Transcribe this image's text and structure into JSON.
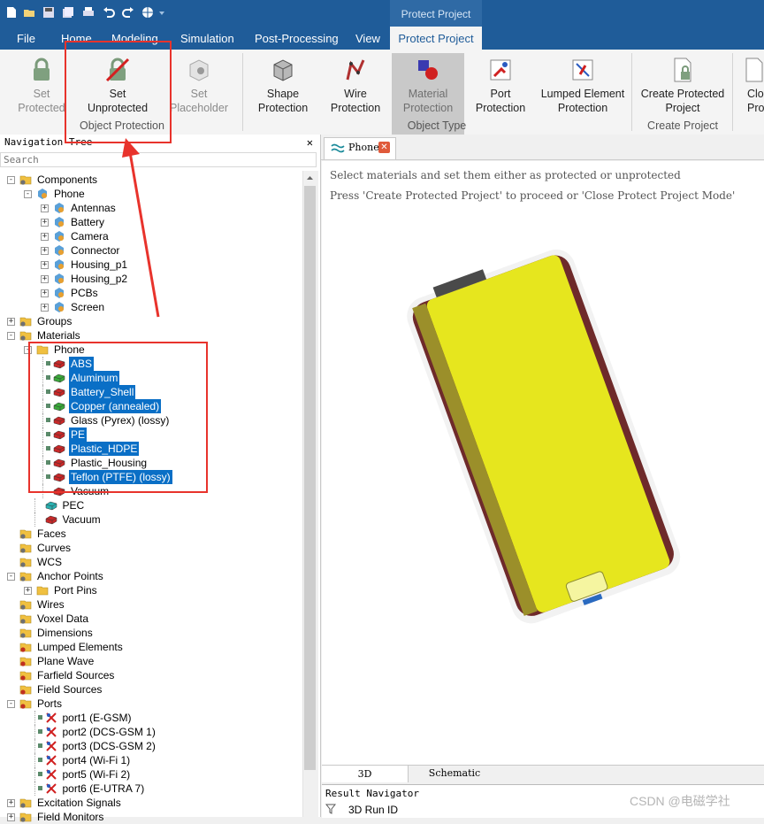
{
  "ribbon": {
    "context_title": "Protect Project",
    "tabs": [
      "File",
      "Home",
      "Modeling",
      "Simulation",
      "Post-Processing",
      "View"
    ],
    "active_tab": "Protect Project",
    "buttons": {
      "set_protected": [
        "Set",
        "Protected"
      ],
      "set_unprotected": [
        "Set",
        "Unprotected"
      ],
      "set_placeholder": [
        "Set",
        "Placeholder"
      ],
      "shape_protection": [
        "Shape",
        "Protection"
      ],
      "wire_protection": [
        "Wire",
        "Protection"
      ],
      "material_protection": [
        "Material",
        "Protection"
      ],
      "port_protection": [
        "Port",
        "Protection"
      ],
      "lumped_element_protection": [
        "Lumped Element",
        "Protection"
      ],
      "create_protected_project": [
        "Create Protected",
        "Project"
      ],
      "close_protect": [
        "Clos",
        "Proj"
      ]
    },
    "groups": {
      "object_protection": "Object Protection",
      "object_type": "Object Type",
      "create_project": "Create Project"
    }
  },
  "nav": {
    "title": "Navigation Tree",
    "close_glyph": "✕",
    "search_placeholder": "Search",
    "rows": [
      {
        "label": "Components",
        "indent": 0,
        "exp": "-",
        "icon": "folder-gear-icon"
      },
      {
        "label": "Phone",
        "indent": 1,
        "exp": "-",
        "icon": "component-icon"
      },
      {
        "label": "Antennas",
        "indent": 2,
        "exp": "+",
        "icon": "component-icon"
      },
      {
        "label": "Battery",
        "indent": 2,
        "exp": "+",
        "icon": "component-icon"
      },
      {
        "label": "Camera",
        "indent": 2,
        "exp": "+",
        "icon": "component-icon"
      },
      {
        "label": "Connector",
        "indent": 2,
        "exp": "+",
        "icon": "component-icon"
      },
      {
        "label": "Housing_p1",
        "indent": 2,
        "exp": "+",
        "icon": "component-icon"
      },
      {
        "label": "Housing_p2",
        "indent": 2,
        "exp": "+",
        "icon": "component-icon"
      },
      {
        "label": "PCBs",
        "indent": 2,
        "exp": "+",
        "icon": "component-icon"
      },
      {
        "label": "Screen",
        "indent": 2,
        "exp": "+",
        "icon": "component-icon"
      },
      {
        "label": "Groups",
        "indent": 0,
        "exp": "+",
        "icon": "folder-gear-icon"
      },
      {
        "label": "Materials",
        "indent": 0,
        "exp": "-",
        "icon": "folder-gear-icon"
      },
      {
        "label": "Phone",
        "indent": 1,
        "exp": "-",
        "icon": "folder-icon"
      },
      {
        "label": "ABS",
        "indent": 2,
        "exp": "",
        "icon": "material-red-icon",
        "lock": true,
        "sel": true
      },
      {
        "label": "Aluminum",
        "indent": 2,
        "exp": "",
        "icon": "material-green-icon",
        "lock": true,
        "sel": true
      },
      {
        "label": "Battery_Shell",
        "indent": 2,
        "exp": "",
        "icon": "material-red-icon",
        "lock": true,
        "sel": true
      },
      {
        "label": "Copper (annealed)",
        "indent": 2,
        "exp": "",
        "icon": "material-green-icon",
        "lock": true,
        "sel": true
      },
      {
        "label": "Glass (Pyrex) (lossy)",
        "indent": 2,
        "exp": "",
        "icon": "material-red-icon",
        "lock": true,
        "sel": false
      },
      {
        "label": "PE",
        "indent": 2,
        "exp": "",
        "icon": "material-red-icon",
        "lock": true,
        "sel": true
      },
      {
        "label": "Plastic_HDPE",
        "indent": 2,
        "exp": "",
        "icon": "material-red-icon",
        "lock": true,
        "sel": true
      },
      {
        "label": "Plastic_Housing",
        "indent": 2,
        "exp": "",
        "icon": "material-red-icon",
        "lock": true,
        "sel": false
      },
      {
        "label": "Teflon (PTFE) (lossy)",
        "indent": 2,
        "exp": "",
        "icon": "material-red-icon",
        "lock": true,
        "sel": true
      },
      {
        "label": "Vacuum",
        "indent": 2,
        "exp": "",
        "icon": "material-red-icon",
        "lock": false,
        "sel": false
      },
      {
        "label": "PEC",
        "indent": 1.5,
        "exp": "",
        "icon": "material-teal-icon",
        "lock": false,
        "sel": false
      },
      {
        "label": "Vacuum",
        "indent": 1.5,
        "exp": "",
        "icon": "material-red-icon",
        "lock": false,
        "sel": false
      },
      {
        "label": "Faces",
        "indent": 0,
        "exp": "",
        "icon": "folder-gear-icon"
      },
      {
        "label": "Curves",
        "indent": 0,
        "exp": "",
        "icon": "folder-gear-icon"
      },
      {
        "label": "WCS",
        "indent": 0,
        "exp": "",
        "icon": "folder-gear-icon"
      },
      {
        "label": "Anchor Points",
        "indent": 0,
        "exp": "-",
        "icon": "folder-gear-icon"
      },
      {
        "label": "Port Pins",
        "indent": 1,
        "exp": "+",
        "icon": "folder-icon"
      },
      {
        "label": "Wires",
        "indent": 0,
        "exp": "",
        "icon": "folder-gear-icon"
      },
      {
        "label": "Voxel Data",
        "indent": 0,
        "exp": "",
        "icon": "folder-gear-icon"
      },
      {
        "label": "Dimensions",
        "indent": 0,
        "exp": "",
        "icon": "folder-gear-icon"
      },
      {
        "label": "Lumped Elements",
        "indent": 0,
        "exp": "",
        "icon": "folder-red-gear-icon"
      },
      {
        "label": "Plane Wave",
        "indent": 0,
        "exp": "",
        "icon": "folder-red-gear-icon"
      },
      {
        "label": "Farfield Sources",
        "indent": 0,
        "exp": "",
        "icon": "folder-red-gear-icon"
      },
      {
        "label": "Field Sources",
        "indent": 0,
        "exp": "",
        "icon": "folder-red-gear-icon"
      },
      {
        "label": "Ports",
        "indent": 0,
        "exp": "-",
        "icon": "folder-red-gear-icon"
      },
      {
        "label": "port1 (E-GSM)",
        "indent": 1.5,
        "exp": "",
        "icon": "port-icon",
        "lock": true
      },
      {
        "label": "port2 (DCS-GSM 1)",
        "indent": 1.5,
        "exp": "",
        "icon": "port-icon",
        "lock": true
      },
      {
        "label": "port3 (DCS-GSM 2)",
        "indent": 1.5,
        "exp": "",
        "icon": "port-icon",
        "lock": true
      },
      {
        "label": "port4 (Wi-Fi 1)",
        "indent": 1.5,
        "exp": "",
        "icon": "port-icon",
        "lock": true
      },
      {
        "label": "port5 (Wi-Fi 2)",
        "indent": 1.5,
        "exp": "",
        "icon": "port-icon",
        "lock": true
      },
      {
        "label": "port6 (E-UTRA 7)",
        "indent": 1.5,
        "exp": "",
        "icon": "port-icon",
        "lock": true
      },
      {
        "label": "Excitation Signals",
        "indent": 0,
        "exp": "+",
        "icon": "folder-gear-icon"
      },
      {
        "label": "Field Monitors",
        "indent": 0,
        "exp": "+",
        "icon": "folder-gear-icon"
      }
    ]
  },
  "workspace": {
    "doc_tab": "Phone",
    "message_line1": "Select materials and set them either as protected or unprotected",
    "message_line2": "Press 'Create Protected Project' to proceed or 'Close Protect Project Mode'",
    "bottom_tabs": [
      "3D",
      "Schematic"
    ],
    "result_nav_title": "Result Navigator",
    "result_nav_col": "3D Run ID"
  },
  "watermark": "CSDN @电磁学社",
  "colors": {
    "ribbon_blue": "#1f5c99",
    "selection_blue": "#0a6fc6",
    "annotation_red": "#e8332c",
    "phone_yellow": "#e6e61e",
    "phone_maroon": "#6e2a2a"
  }
}
